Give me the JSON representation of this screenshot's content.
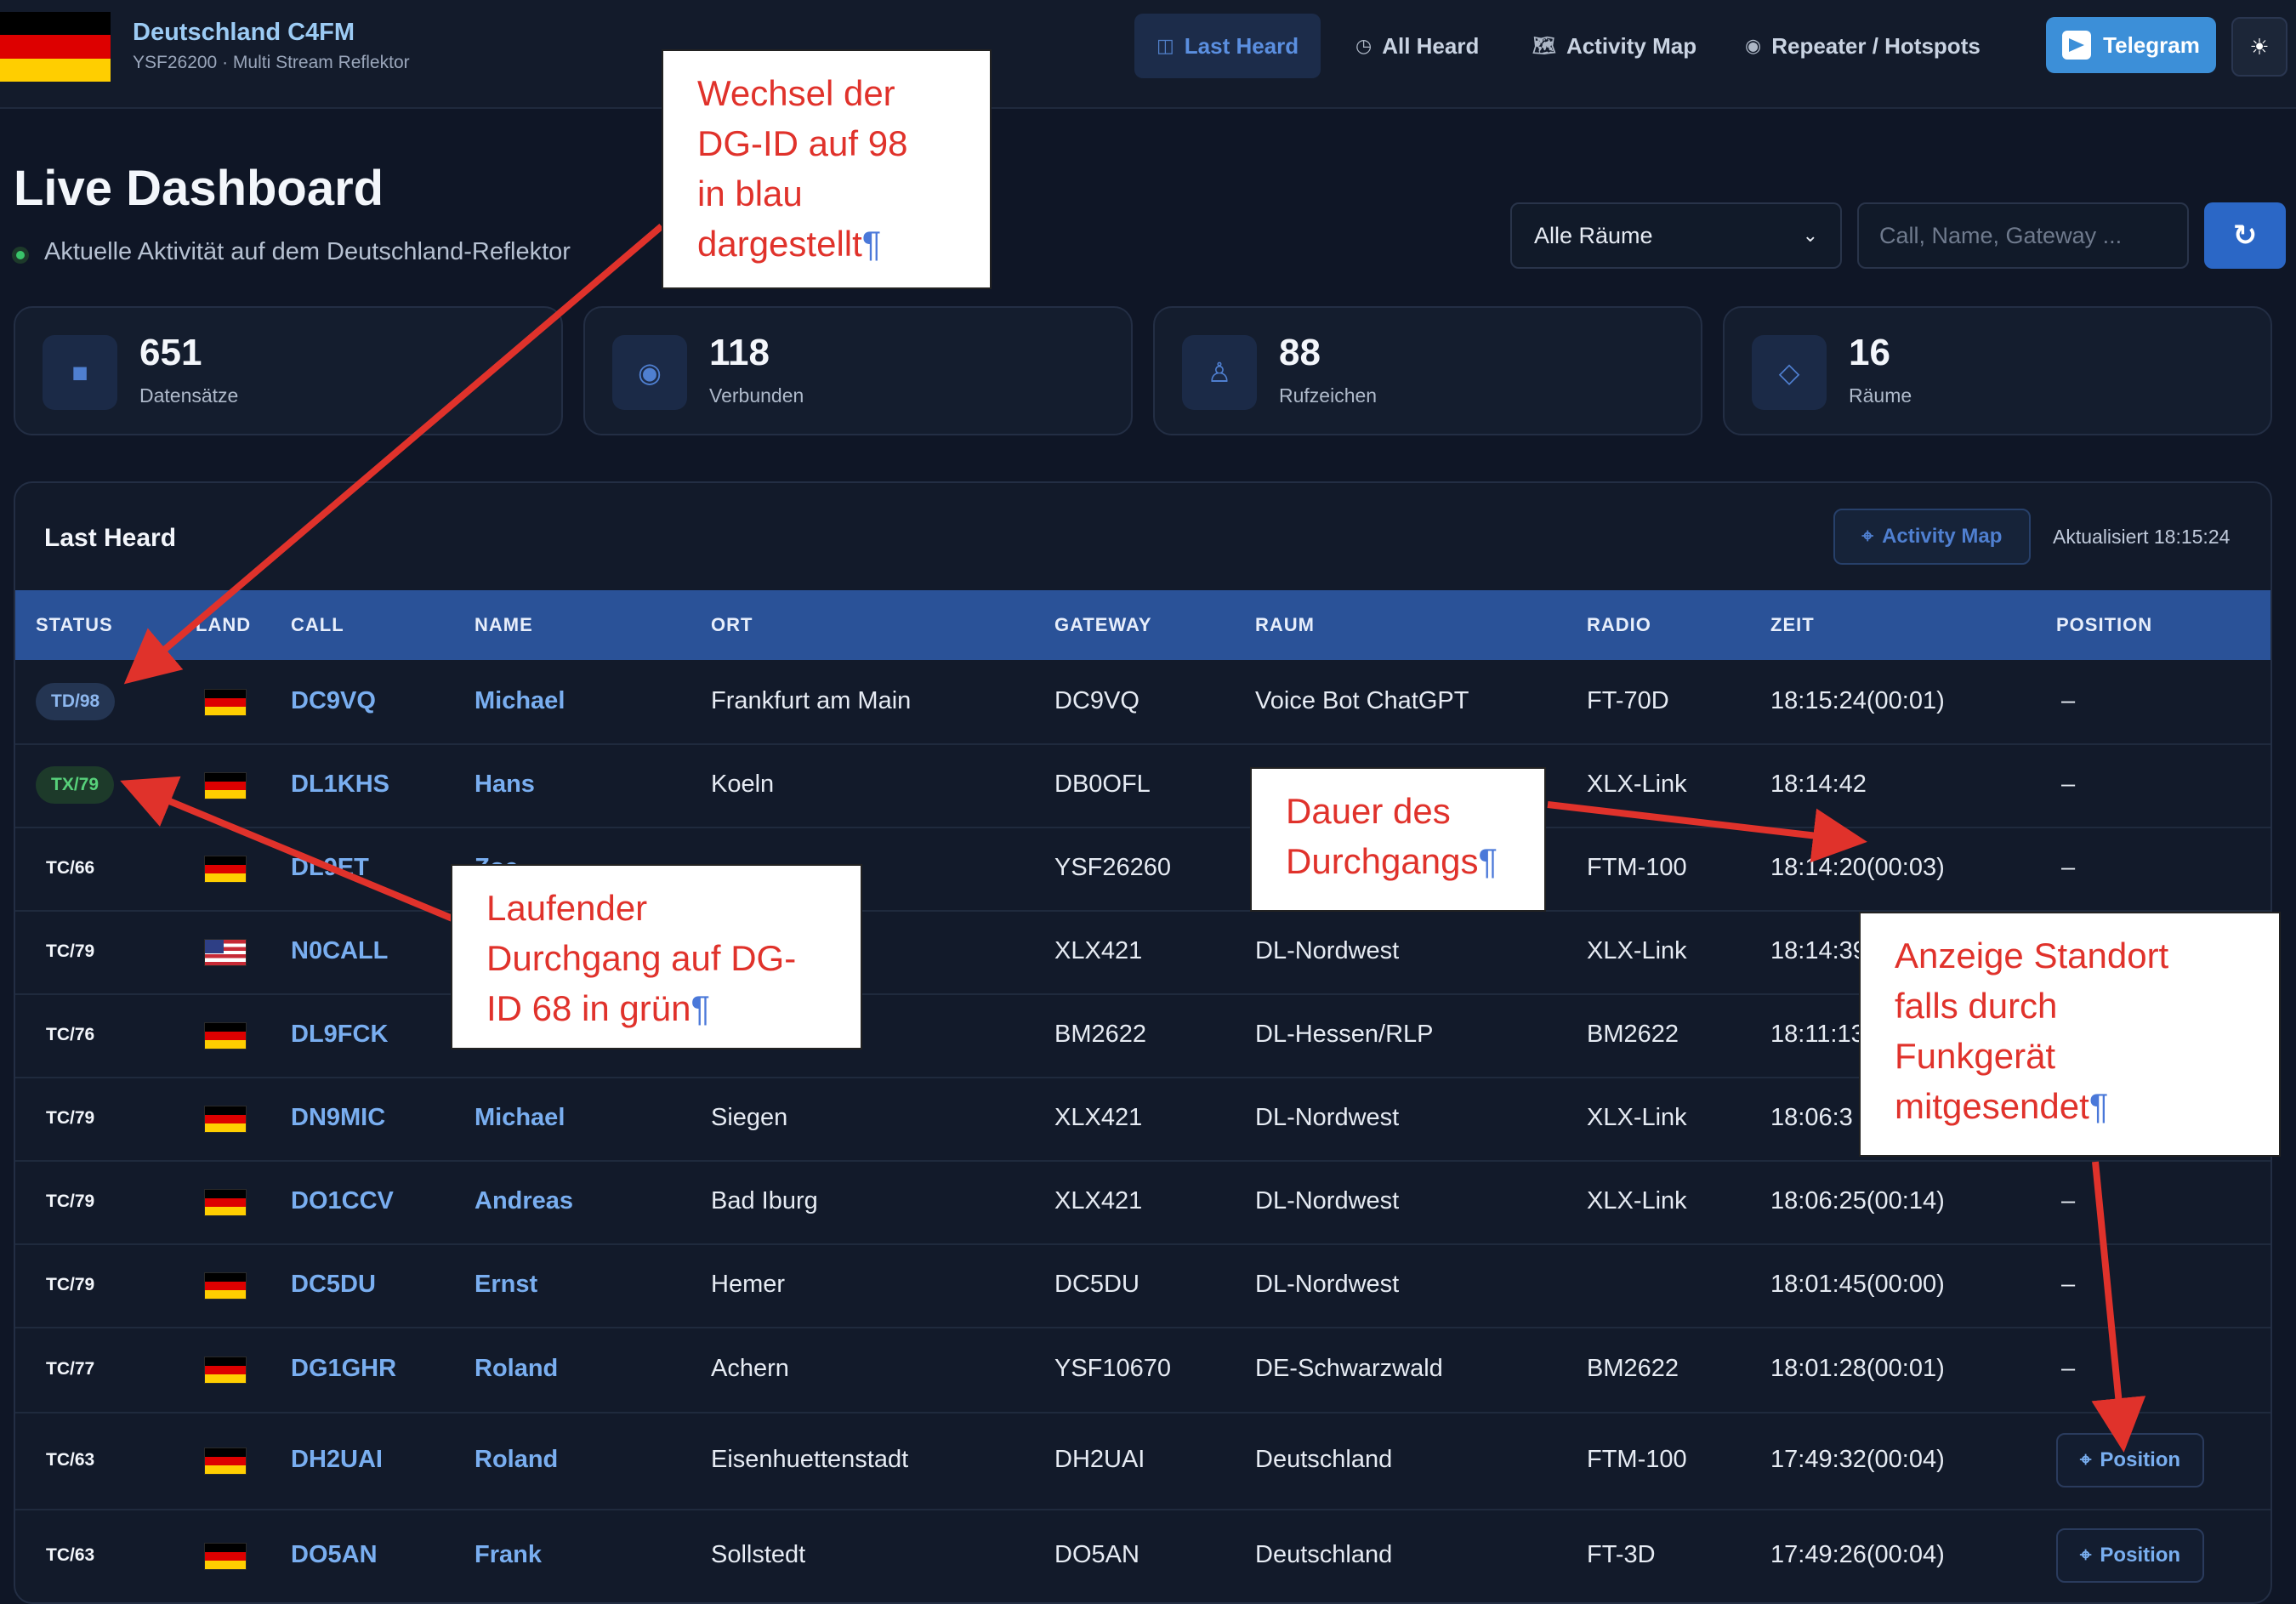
{
  "header": {
    "brand_title": "Deutschland C4FM",
    "brand_sub": "YSF26200 · Multi Stream Reflektor",
    "nav": [
      {
        "label": "Last Heard",
        "icon": "◫",
        "icon_name": "dashboard-icon",
        "active": true
      },
      {
        "label": "All Heard",
        "icon": "◷",
        "icon_name": "clock-icon",
        "active": false
      },
      {
        "label": "Activity Map",
        "icon": "🗺",
        "icon_name": "map-icon",
        "active": false
      },
      {
        "label": "Repeater / Hotspots",
        "icon": "◉",
        "icon_name": "radio-icon",
        "active": false
      }
    ],
    "telegram_label": "Telegram",
    "theme_icon": "☀"
  },
  "title": {
    "heading": "Live Dashboard",
    "subtitle": "Aktuelle Aktivität auf dem Deutschland-Reflektor"
  },
  "filters": {
    "room_selected": "Alle Räume",
    "search_placeholder": "Call, Name, Gateway ...",
    "refresh_icon": "↻"
  },
  "stats": [
    {
      "value": "651",
      "label": "Datensätze",
      "icon": "■"
    },
    {
      "value": "118",
      "label": "Verbunden",
      "icon": "◉"
    },
    {
      "value": "88",
      "label": "Rufzeichen",
      "icon": "♙"
    },
    {
      "value": "16",
      "label": "Räume",
      "icon": "◇"
    }
  ],
  "table": {
    "title": "Last Heard",
    "activity_map_label": "Activity Map",
    "updated": "Aktualisiert 18:15:24",
    "columns": [
      "STATUS",
      "LAND",
      "CALL",
      "NAME",
      "ORT",
      "GATEWAY",
      "RAUM",
      "RADIO",
      "ZEIT",
      "POSITION"
    ],
    "position_label": "Position",
    "rows": [
      {
        "status": "TD/98",
        "style": "blue",
        "country": "de",
        "call": "DC9VQ",
        "name": "Michael",
        "ort": "Frankfurt am Main",
        "gateway": "DC9VQ",
        "raum": "Voice Bot ChatGPT",
        "radio": "FT-70D",
        "zeit": "18:15:24(00:01)",
        "position": "–"
      },
      {
        "status": "TX/79",
        "style": "green",
        "country": "de",
        "call": "DL1KHS",
        "name": "Hans",
        "ort": "Koeln",
        "gateway": "DB0OFL",
        "raum": "",
        "radio": "XLX-Link",
        "zeit": "18:14:42",
        "position": "–"
      },
      {
        "status": "TC/66",
        "style": "plain",
        "country": "de",
        "call": "DL9ET",
        "name": "Zoe",
        "ort": "",
        "gateway": "YSF26260",
        "raum": "",
        "radio": "FTM-100",
        "zeit": "18:14:20(00:03)",
        "position": "–"
      },
      {
        "status": "TC/79",
        "style": "plain",
        "country": "us",
        "call": "N0CALL",
        "name": "",
        "ort": "",
        "gateway": "XLX421",
        "raum": "DL-Nordwest",
        "radio": "XLX-Link",
        "zeit": "18:14:39",
        "position": ""
      },
      {
        "status": "TC/76",
        "style": "plain",
        "country": "de",
        "call": "DL9FCK",
        "name": "",
        "ort": "",
        "gateway": "BM2622",
        "raum": "DL-Hessen/RLP",
        "radio": "BM2622",
        "zeit": "18:11:13",
        "position": ""
      },
      {
        "status": "TC/79",
        "style": "plain",
        "country": "de",
        "call": "DN9MIC",
        "name": "Michael",
        "ort": "Siegen",
        "gateway": "XLX421",
        "raum": "DL-Nordwest",
        "radio": "XLX-Link",
        "zeit": "18:06:3",
        "position": ""
      },
      {
        "status": "TC/79",
        "style": "plain",
        "country": "de",
        "call": "DO1CCV",
        "name": "Andreas",
        "ort": "Bad Iburg",
        "gateway": "XLX421",
        "raum": "DL-Nordwest",
        "radio": "XLX-Link",
        "zeit": "18:06:25(00:14)",
        "position": "–"
      },
      {
        "status": "TC/79",
        "style": "plain",
        "country": "de",
        "call": "DC5DU",
        "name": "Ernst",
        "ort": "Hemer",
        "gateway": "DC5DU",
        "raum": "DL-Nordwest",
        "radio": "",
        "zeit": "18:01:45(00:00)",
        "position": "–"
      },
      {
        "status": "TC/77",
        "style": "plain",
        "country": "de",
        "call": "DG1GHR",
        "name": "Roland",
        "ort": "Achern",
        "gateway": "YSF10670",
        "raum": "DE-Schwarzwald",
        "radio": "BM2622",
        "zeit": "18:01:28(00:01)",
        "position": "–"
      },
      {
        "status": "TC/63",
        "style": "plain",
        "country": "de",
        "call": "DH2UAI",
        "name": "Roland",
        "ort": "Eisenhuettenstadt",
        "gateway": "DH2UAI",
        "raum": "Deutschland",
        "radio": "FTM-100",
        "zeit": "17:49:32(00:04)",
        "position": "button"
      },
      {
        "status": "TC/63",
        "style": "plain",
        "country": "de",
        "call": "DO5AN",
        "name": "Frank",
        "ort": "Sollstedt",
        "gateway": "DO5AN",
        "raum": "Deutschland",
        "radio": "FT-3D",
        "zeit": "17:49:26(00:04)",
        "position": "button"
      }
    ]
  },
  "annotations": [
    {
      "lines": [
        "Wechsel der",
        "DG-ID auf 98",
        "in blau",
        "dargestellt"
      ]
    },
    {
      "lines": [
        "Laufender",
        "Durchgang auf DG-",
        "ID 68 in grün"
      ]
    },
    {
      "lines": [
        "Dauer des",
        "Durchgangs"
      ]
    },
    {
      "lines": [
        "Anzeige Standort",
        "falls durch",
        "Funkgerät",
        "mitgesendet"
      ]
    }
  ],
  "colors": {
    "background": "#0f1626",
    "table_header": "#2a5298",
    "link": "#79aef0",
    "status_blue": "#8db7ee",
    "status_green": "#57d07a",
    "annotation_red": "#e0322b",
    "telegram": "#3c8fd8"
  }
}
